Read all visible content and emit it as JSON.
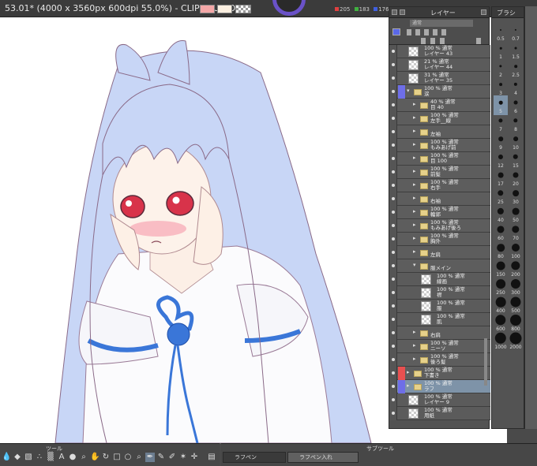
{
  "window": {
    "title": "53.01* (4000 x 3560px 600dpi 55.0%)  - CLIP STUDIO"
  },
  "color": {
    "main": "#f4a7a7",
    "sub": "#fbefe0",
    "rgb": {
      "r": "205",
      "g": "183",
      "b": "176"
    }
  },
  "layer_panel": {
    "title": "レイヤー",
    "blend_mode": "通常",
    "layers": [
      {
        "type": "layer",
        "opacity": "100 %  通常",
        "name": "レイヤー 43",
        "indent": 0
      },
      {
        "type": "layer",
        "opacity": "21 %  通常",
        "name": "レイヤー 44",
        "indent": 0
      },
      {
        "type": "layer",
        "opacity": "31 %  通常",
        "name": "レイヤー 35",
        "indent": 0
      },
      {
        "type": "folder",
        "opacity": "100 %  通常",
        "name": "涙",
        "indent": 0,
        "open": true,
        "mark": "#6e6ee8"
      },
      {
        "type": "folder",
        "opacity": "40 %  通常",
        "name": "目 40",
        "indent": 1
      },
      {
        "type": "folder",
        "opacity": "100 %  通常",
        "name": "左手__線",
        "indent": 1
      },
      {
        "type": "folder",
        "opacity": "",
        "name": "左袖",
        "indent": 1
      },
      {
        "type": "folder",
        "opacity": "100 %  通常",
        "name": "もみあげ前",
        "indent": 1
      },
      {
        "type": "folder",
        "opacity": "100 %  通常",
        "name": "目 100",
        "indent": 1
      },
      {
        "type": "folder",
        "opacity": "100 %  通常",
        "name": "前髪",
        "indent": 1
      },
      {
        "type": "folder",
        "opacity": "100 %  通常",
        "name": "右手",
        "indent": 1
      },
      {
        "type": "folder",
        "opacity": "",
        "name": "右袖",
        "indent": 1
      },
      {
        "type": "folder",
        "opacity": "100 %  通常",
        "name": "輪郭",
        "indent": 1
      },
      {
        "type": "folder",
        "opacity": "100 %  通常",
        "name": "もみあげ後ろ",
        "indent": 1
      },
      {
        "type": "folder",
        "opacity": "100 %  通常",
        "name": "胸外",
        "indent": 1
      },
      {
        "type": "folder",
        "opacity": "",
        "name": "左肩",
        "indent": 1
      },
      {
        "type": "folder",
        "opacity": "",
        "name": "服メイン",
        "indent": 1,
        "open": true
      },
      {
        "type": "layer",
        "opacity": "100 %  通常",
        "name": "線画",
        "indent": 2
      },
      {
        "type": "layer",
        "opacity": "100 %  通常",
        "name": "襟",
        "indent": 2
      },
      {
        "type": "layer",
        "opacity": "100 %  通常",
        "name": "服",
        "indent": 2
      },
      {
        "type": "layer",
        "opacity": "100 %  通常",
        "name": "肌",
        "indent": 2
      },
      {
        "type": "folder",
        "opacity": "",
        "name": "右肩",
        "indent": 1
      },
      {
        "type": "folder",
        "opacity": "100 %  通常",
        "name": "ニーソ",
        "indent": 1
      },
      {
        "type": "folder",
        "opacity": "100 %  通常",
        "name": "後ろ髪",
        "indent": 1
      },
      {
        "type": "folder",
        "opacity": "100 %  通常",
        "name": "下書き",
        "indent": 0,
        "mark": "#e85050"
      },
      {
        "type": "folder",
        "opacity": "100 %  通常",
        "name": "ラフ",
        "indent": 0,
        "mark": "#6e6ee8",
        "selected": true
      },
      {
        "type": "layer",
        "opacity": "100 %  通常",
        "name": "レイヤー 9",
        "indent": 0
      },
      {
        "type": "layer",
        "opacity": "100 %  通常",
        "name": "用紙",
        "indent": 0
      }
    ]
  },
  "brush_panel": {
    "title": "ブラシ",
    "sizes": [
      "0.5",
      "0.7",
      "1",
      "1.5",
      "2",
      "2.5",
      "3",
      "4",
      "5",
      "6",
      "7",
      "8",
      "9",
      "10",
      "12",
      "15",
      "17",
      "20",
      "25",
      "30",
      "40",
      "50",
      "60",
      "70",
      "80",
      "100",
      "150",
      "200",
      "250",
      "300",
      "400",
      "500",
      "600",
      "800",
      "1000",
      "2000"
    ],
    "selected": "5"
  },
  "tool_panel": {
    "title": "ツール"
  },
  "subtool_panel": {
    "title": "サブツール",
    "tabs": [
      "ラフペン",
      "ラフペン入れ"
    ]
  }
}
